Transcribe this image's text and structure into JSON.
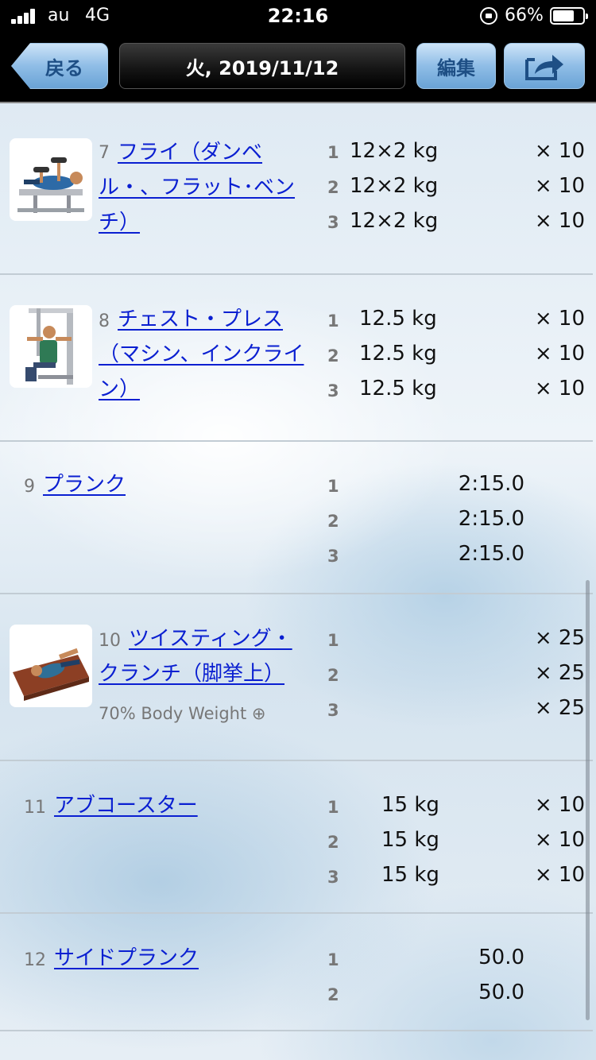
{
  "statusbar": {
    "carrier": "au",
    "network": "4G",
    "time": "22:16",
    "battery": "66%",
    "battery_level": 0.66
  },
  "navbar": {
    "back_label": "戻る",
    "title": "火, 2019/11/12",
    "edit_label": "編集",
    "share_icon": "share-icon"
  },
  "exercises": [
    {
      "number": "7",
      "name": "フライ（ダンベル・、フラット･ベンチ）",
      "name_lines": [
        "フライ（ダンベ",
        "ル・、フラット･ベン",
        "チ）"
      ],
      "thumbnail": "dumbbell-fly-icon",
      "sets": [
        {
          "set": "1",
          "weight": "12×2 kg",
          "reps": "× 10"
        },
        {
          "set": "2",
          "weight": "12×2 kg",
          "reps": "× 10"
        },
        {
          "set": "3",
          "weight": "12×2 kg",
          "reps": "× 10"
        }
      ]
    },
    {
      "number": "8",
      "name": "チェスト・プレス（マシン、インクライン）",
      "name_lines": [
        "チェスト・プレス",
        "（マシン、インクライ",
        "ン）"
      ],
      "thumbnail": "chest-press-machine-icon",
      "sets": [
        {
          "set": "1",
          "weight": "12.5 kg",
          "reps": "× 10"
        },
        {
          "set": "2",
          "weight": "12.5 kg",
          "reps": "× 10"
        },
        {
          "set": "3",
          "weight": "12.5 kg",
          "reps": "× 10"
        }
      ]
    },
    {
      "number": "9",
      "name": "プランク",
      "sets": [
        {
          "set": "1",
          "time": "2:15.0"
        },
        {
          "set": "2",
          "time": "2:15.0"
        },
        {
          "set": "3",
          "time": "2:15.0"
        }
      ]
    },
    {
      "number": "10",
      "name": "ツイスティング・クランチ（脚挙上）",
      "name_lines": [
        "ツイスティング・",
        "クランチ（脚挙上）"
      ],
      "thumbnail": "twisting-crunch-icon",
      "note": "70% Body Weight ⊕",
      "sets": [
        {
          "set": "1",
          "reps": "× 25"
        },
        {
          "set": "2",
          "reps": "× 25"
        },
        {
          "set": "3",
          "reps": "× 25"
        }
      ]
    },
    {
      "number": "11",
      "name": "アブコースター",
      "sets": [
        {
          "set": "1",
          "weight": "15 kg",
          "reps": "× 10"
        },
        {
          "set": "2",
          "weight": "15 kg",
          "reps": "× 10"
        },
        {
          "set": "3",
          "weight": "15 kg",
          "reps": "× 10"
        }
      ]
    },
    {
      "number": "12",
      "name": "サイドプランク",
      "sets": [
        {
          "set": "1",
          "time": "50.0"
        },
        {
          "set": "2",
          "time": "50.0"
        }
      ]
    }
  ]
}
